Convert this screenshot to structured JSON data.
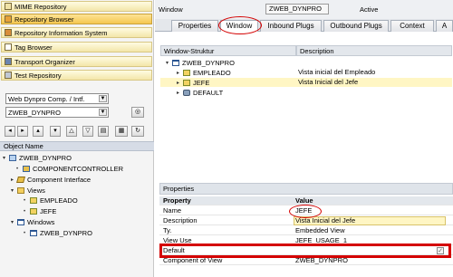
{
  "left": {
    "nav": [
      {
        "label": "MIME Repository",
        "icon": "mime-repository-icon",
        "selected": false
      },
      {
        "label": "Repository Browser",
        "icon": "repository-browser-icon",
        "selected": true
      },
      {
        "label": "Repository Information System",
        "icon": "info-system-icon",
        "selected": false
      },
      {
        "label": "Tag Browser",
        "icon": "tag-browser-icon",
        "selected": false
      },
      {
        "label": "Transport Organizer",
        "icon": "transport-organizer-icon",
        "selected": false
      },
      {
        "label": "Test Repository",
        "icon": "test-repository-icon",
        "selected": false
      }
    ],
    "type_select": "Web Dynpro Comp. / Intf.",
    "object_input": "ZWEB_DYNPRO",
    "object_name_header": "Object Name",
    "tree": [
      {
        "label": "ZWEB_DYNPRO",
        "icon": "component-icon",
        "expanded": true
      },
      {
        "label": "COMPONENTCONTROLLER",
        "icon": "controller-icon"
      },
      {
        "label": "Component Interface",
        "icon": "interface-icon"
      },
      {
        "label": "Views",
        "icon": "folder-icon",
        "expanded": true
      },
      {
        "label": "EMPLEADO",
        "icon": "view-icon"
      },
      {
        "label": "JEFE",
        "icon": "view-icon"
      },
      {
        "label": "Windows",
        "icon": "folder-icon",
        "expanded": true
      },
      {
        "label": "ZWEB_DYNPRO",
        "icon": "window-icon"
      }
    ]
  },
  "header": {
    "label": "Window",
    "value": "ZWEB_DYNPRO",
    "status": "Active"
  },
  "tabs": [
    {
      "label": "Properties",
      "active": false
    },
    {
      "label": "Window",
      "active": true
    },
    {
      "label": "Inbound Plugs",
      "active": false
    },
    {
      "label": "Outbound Plugs",
      "active": false
    },
    {
      "label": "Context",
      "active": false
    },
    {
      "label": "A",
      "active": false
    }
  ],
  "structure": {
    "col1": "Window-Struktur",
    "col2": "Description",
    "rows": [
      {
        "name": "ZWEB_DYNPRO",
        "description": "",
        "icon": "window-icon"
      },
      {
        "name": "EMPLEADO",
        "description": "Vista inicial del Empleado",
        "icon": "view-icon"
      },
      {
        "name": "JEFE",
        "description": "Vista Inicial del Jefe",
        "icon": "view-icon",
        "highlighted": true
      },
      {
        "name": "DEFAULT",
        "description": "",
        "icon": "plug-icon"
      }
    ]
  },
  "properties": {
    "title": "Properties",
    "col_property": "Property",
    "col_value": "Value",
    "rows": [
      {
        "key": "Name",
        "value": "JEFE"
      },
      {
        "key": "Description",
        "value": "Vista Inicial del Jefe",
        "highlighted": true
      },
      {
        "key": "Ty.",
        "value": "Embedded View"
      },
      {
        "key": "View Use",
        "value": "JEFE_USAGE_1"
      },
      {
        "key": "Default",
        "value": "",
        "checkbox": true,
        "checkmark": "✓"
      },
      {
        "key": "Component of View",
        "value": "ZWEB_DYNPRO"
      }
    ]
  },
  "annotation_color": "#d40000"
}
